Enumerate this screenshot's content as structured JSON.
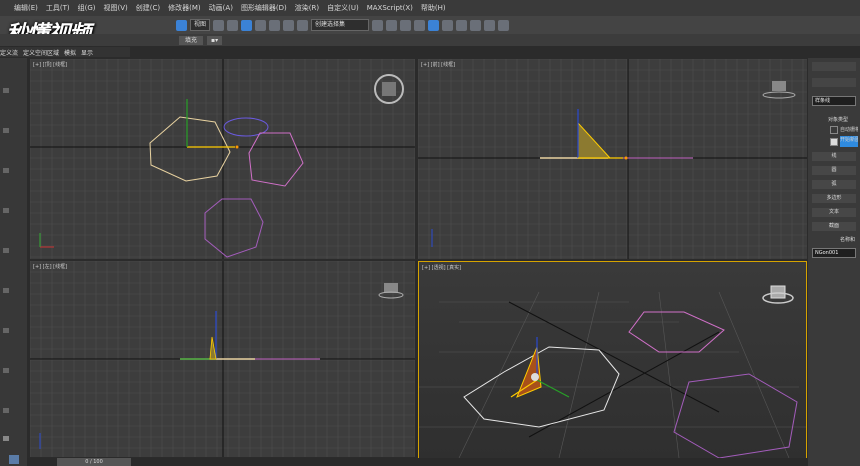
{
  "menu": [
    "编辑(E)",
    "工具(T)",
    "组(G)",
    "视图(V)",
    "创建(C)",
    "修改器(M)",
    "动画(A)",
    "图形编辑器(D)",
    "渲染(R)",
    "自定义(U)",
    "MAXScript(X)",
    "帮助(H)"
  ],
  "watermark": "秒懂视频",
  "toolbar": {
    "view_select": "视图",
    "named_set": "创建选择集"
  },
  "ribbon": {
    "fill_label": "填充"
  },
  "tabs": [
    "定义流",
    "定义空间区域",
    "模拟",
    "显示"
  ],
  "viewports": [
    {
      "label": "[+] [顶] [线框]"
    },
    {
      "label": "[+] [前] [线框]"
    },
    {
      "label": "[+] [左] [线框]"
    },
    {
      "label": "[+] [透视] [真实]"
    }
  ],
  "right_panel": {
    "category": "样条线",
    "rollout_object_type": "对象类型",
    "autogrid": "自动栅格",
    "start_new": "开始新图形",
    "objects": [
      "线",
      "圆",
      "弧",
      "多边形",
      "文本",
      "截面"
    ],
    "rollout_name": "名称和",
    "name_value": "NGon001"
  },
  "timeline": {
    "frame": "0 / 100"
  },
  "colors": {
    "viewport_bg": "#3d3d3d",
    "active_border": "#d6a300",
    "hexagon_yellow": "#e8d2a0",
    "pentagon_pink": "#d070c8",
    "selection_blue": "#3b82d6"
  }
}
